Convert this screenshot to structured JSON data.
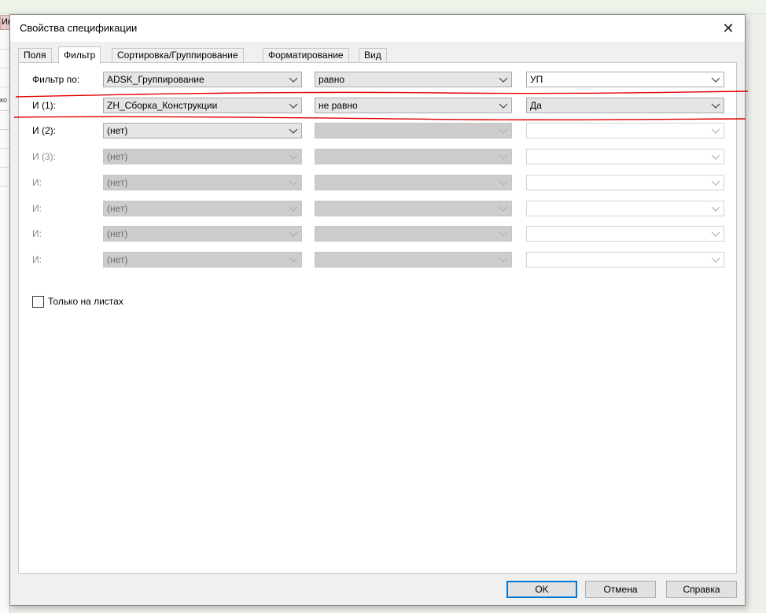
{
  "background": {
    "tab_fragment": "Ик",
    "side_text": "ко"
  },
  "dialog": {
    "title": "Свойства спецификации",
    "close_glyph": "✕"
  },
  "tabs": [
    {
      "label": "Поля",
      "active": false
    },
    {
      "label": "Фильтр",
      "active": true
    },
    {
      "label": "Сортировка/Группирование",
      "active": false
    },
    {
      "label": "Форматирование",
      "active": false
    },
    {
      "label": "Вид",
      "active": false
    }
  ],
  "filter_rows": [
    {
      "label": "Фильтр по:",
      "enabled": true,
      "field": "ADSK_Группирование",
      "condition": "равно",
      "value": "УП"
    },
    {
      "label": "И (1):",
      "enabled": true,
      "field": "ZH_Сборка_Конструкции",
      "condition": "не равно",
      "value": "Да"
    },
    {
      "label": "И (2):",
      "enabled": true,
      "field": "(нет)",
      "condition": "",
      "value": ""
    },
    {
      "label": "И (3):",
      "enabled": false,
      "field": "(нет)",
      "condition": "",
      "value": ""
    },
    {
      "label": "И:",
      "enabled": false,
      "field": "(нет)",
      "condition": "",
      "value": ""
    },
    {
      "label": "И:",
      "enabled": false,
      "field": "(нет)",
      "condition": "",
      "value": ""
    },
    {
      "label": "И:",
      "enabled": false,
      "field": "(нет)",
      "condition": "",
      "value": ""
    },
    {
      "label": "И:",
      "enabled": false,
      "field": "(нет)",
      "condition": "",
      "value": ""
    }
  ],
  "sheets_only": {
    "label": "Только на листах",
    "checked": false
  },
  "buttons": {
    "ok": "OK",
    "cancel": "Отмена",
    "help": "Справка"
  },
  "colors": {
    "annotation_red": "#e00000",
    "default_button_border": "#0078d7"
  }
}
